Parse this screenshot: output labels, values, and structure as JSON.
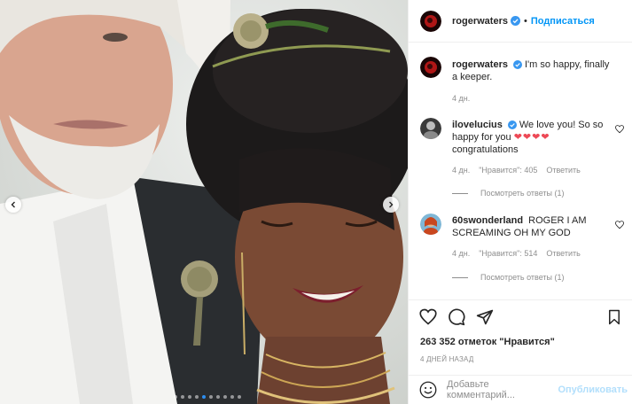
{
  "post": {
    "author": "rogerwaters",
    "follow_separator": "•",
    "follow_label": "Подписаться",
    "caption": "I'm so happy, finally a keeper.",
    "caption_time": "4 дн."
  },
  "comments": [
    {
      "user": "ilovelucius",
      "text": "We love you! So so happy for you",
      "emoji": "❤❤❤❤",
      "text2": "congratulations",
      "time": "4 дн.",
      "likes": "\"Нравится\": 405",
      "reply": "Ответить",
      "view_replies": "Посмотреть ответы (1)"
    },
    {
      "user": "60swonderland",
      "text": "ROGER I AM SCREAMING OH MY GOD",
      "time": "4 дн.",
      "likes": "\"Нравится\": 514",
      "reply": "Ответить",
      "view_replies": "Посмотреть ответы (1)"
    }
  ],
  "likes_total": "263 352 отметок \"Нравится\"",
  "time_ago": "4 ДНЕЙ НАЗАД",
  "add_comment": {
    "placeholder": "Добавьте комментарий...",
    "publish_label": "Опубликовать"
  },
  "icons": {
    "like": "heart-icon",
    "comment": "comment-icon",
    "share": "share-icon",
    "save": "bookmark-icon",
    "emoji": "emoji-icon",
    "verified": "verified-badge-icon"
  },
  "colors": {
    "link_blue": "#0095f6",
    "verified_blue": "#3897f0",
    "heart_red": "#ed4956"
  }
}
